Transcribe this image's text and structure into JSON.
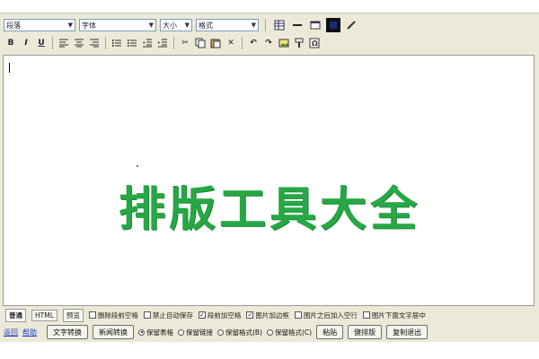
{
  "toolbar": {
    "paragraph_select": "段落",
    "font_select": "字体",
    "size_select": "大小",
    "style_select": "格式"
  },
  "editor": {
    "title_text": "排版工具大全",
    "title_color": "#27a745"
  },
  "options": {
    "tabs": [
      "普通",
      "HTML",
      "预览"
    ],
    "checkboxes": [
      {
        "label": "删除段前空格",
        "checked": false
      },
      {
        "label": "禁止自动保存",
        "checked": false
      },
      {
        "label": "段前加空格",
        "checked": true
      },
      {
        "label": "图片加边框",
        "checked": true
      },
      {
        "label": "图片之后加入空行",
        "checked": false
      },
      {
        "label": "图片下面文字居中",
        "checked": false
      }
    ]
  },
  "bottom": {
    "links": [
      "返回",
      "帮助"
    ],
    "buttons": [
      "文字转换",
      "新闻转换",
      "粘贴",
      "健排版",
      "复制退出"
    ],
    "radios": [
      {
        "label": "保留表格",
        "checked": true
      },
      {
        "label": "保留链接",
        "checked": false
      },
      {
        "label": "保留格式(B)",
        "checked": false
      },
      {
        "label": "保留格式(C)",
        "checked": false
      }
    ]
  }
}
